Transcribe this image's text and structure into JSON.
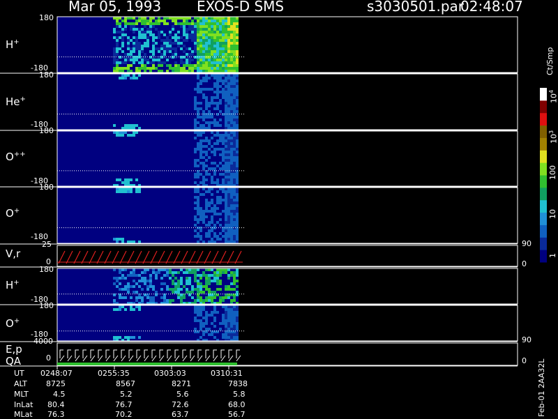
{
  "header": {
    "date": "Mar 05, 1993",
    "instrument": "EXOS-D SMS",
    "file": "s3030501.par",
    "time": "02:48:07"
  },
  "panels": [
    {
      "label": "H",
      "charge": "+",
      "top": "180",
      "bottom": "-180"
    },
    {
      "label": "He",
      "charge": "+",
      "top": "180",
      "bottom": "-180"
    },
    {
      "label": "O",
      "charge": "++",
      "top": "180",
      "bottom": "-180"
    },
    {
      "label": "O",
      "charge": "+",
      "top": "180",
      "bottom": "-180"
    },
    {
      "label": "V,r",
      "charge": "",
      "top": "25",
      "bottom": "0",
      "right_top": "90",
      "right_bottom": "0"
    },
    {
      "label": "H",
      "charge": "+",
      "top": "180",
      "bottom": "-180"
    },
    {
      "label": "O",
      "charge": "+",
      "top": "180",
      "bottom": "-180"
    },
    {
      "label": "E,p",
      "label2": "QA",
      "charge": "",
      "top": "4000",
      "bottom": "0",
      "right_top": "90",
      "right_bottom": "0"
    }
  ],
  "colorbar": {
    "unit": "Ct/Smp",
    "ticks": [
      "10",
      "4",
      "10",
      "3",
      "100",
      "10",
      "1"
    ],
    "tick_labels": [
      {
        "base": "10",
        "exp": "4"
      },
      {
        "base": "10",
        "exp": "3"
      },
      {
        "base": "100",
        "exp": ""
      },
      {
        "base": "10",
        "exp": ""
      },
      {
        "base": "1",
        "exp": ""
      }
    ]
  },
  "footer": {
    "rows": [
      {
        "name": "UT",
        "values": [
          "0248:07",
          "0255:35",
          "0303:03",
          "0310:31"
        ]
      },
      {
        "name": "ALT",
        "values": [
          "8725",
          "8567",
          "8271",
          "7838"
        ]
      },
      {
        "name": "MLT",
        "values": [
          "4.5",
          "5.2",
          "5.6",
          "5.8"
        ]
      },
      {
        "name": "InLat",
        "values": [
          "80.4",
          "76.7",
          "72.6",
          "68.0"
        ]
      },
      {
        "name": "MLat",
        "values": [
          "76.3",
          "70.2",
          "63.7",
          "56.7"
        ]
      }
    ],
    "side_text": "Feb-01 2AA32L"
  },
  "chart_data": {
    "type": "heatmap",
    "title": "Mar 05, 1993   EXOS-D SMS",
    "x": [
      "0248:07",
      "0255:35",
      "0303:03",
      "0310:31"
    ],
    "ylim_pitch": [
      -180,
      180
    ],
    "colorscale": [
      "#000080",
      "#0a2a9a",
      "#1060c0",
      "#2090d8",
      "#20c0d0",
      "#10a060",
      "#30c030",
      "#80e020",
      "#e0e020",
      "#a08000",
      "#806000",
      "#e01010",
      "#800000",
      "#ffffff"
    ],
    "color_range": [
      1,
      10000
    ],
    "log_scale": true
  }
}
